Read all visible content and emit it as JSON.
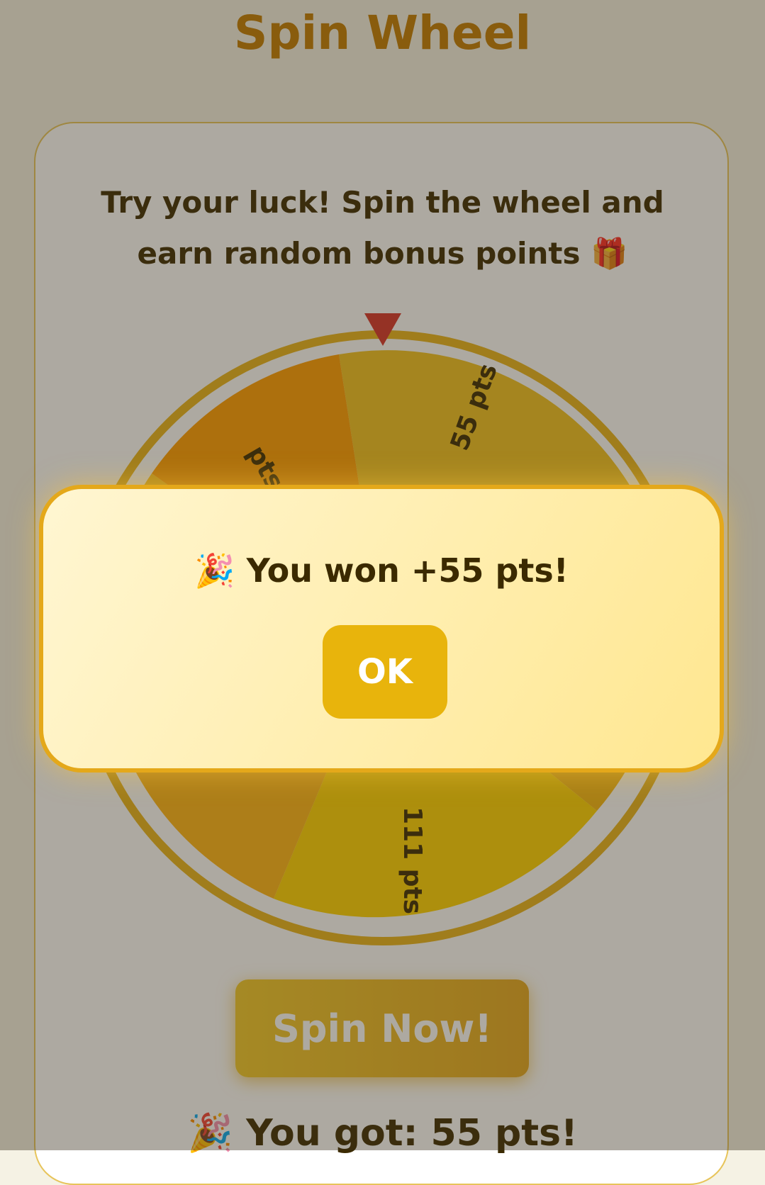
{
  "header": {
    "title": "Spin Wheel"
  },
  "intro": {
    "line1": "Try your luck! Spin the wheel and",
    "line2": "earn random bonus points",
    "gift_emoji": "🎁"
  },
  "wheel": {
    "segments": [
      {
        "label": "55 pts",
        "color": "#f5c518"
      },
      {
        "label": "111 pts",
        "color": "#ffd700"
      },
      {
        "label": "pts",
        "color": "#ff9f0a"
      }
    ],
    "rim_color": "#e9b31a",
    "pointer_color": "#d6322a"
  },
  "actions": {
    "spin_label": "Spin Now!"
  },
  "result": {
    "emoji": "🎉",
    "text": "You got: 55 pts!"
  },
  "modal": {
    "emoji": "🎉",
    "message": "You won +55 pts!",
    "ok_label": "OK"
  }
}
